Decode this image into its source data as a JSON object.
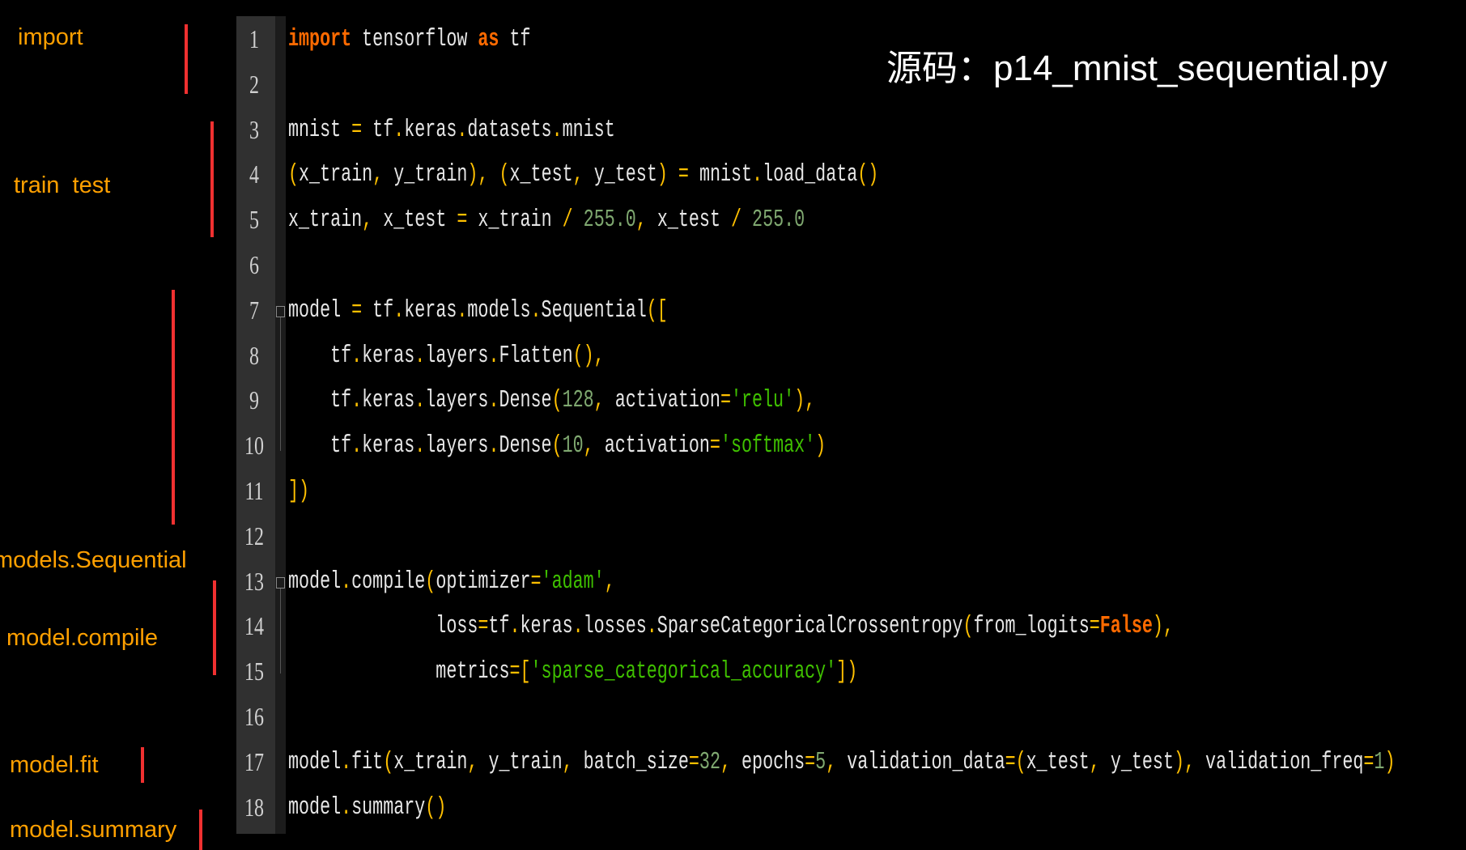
{
  "title": "源码：p14_mnist_sequential.py",
  "labels": [
    "import",
    "train  test",
    "models.Sequential",
    "model.compile",
    "model.fit",
    "model.summary"
  ],
  "colors": {
    "keyword": "#ff6a00",
    "operator": "#ffc000",
    "number": "#7fa870",
    "string": "#3fc000",
    "text": "#e6e6e6",
    "label": "#ffa000",
    "bar": "#f03030"
  },
  "code": [
    [
      [
        "import",
        "kw"
      ],
      [
        " tensorflow ",
        ""
      ],
      [
        "as",
        "kw"
      ],
      [
        " tf",
        ""
      ]
    ],
    [],
    [
      [
        "mnist ",
        ""
      ],
      [
        "=",
        "op"
      ],
      [
        " tf",
        ""
      ],
      [
        ".",
        "op"
      ],
      [
        "keras",
        ""
      ],
      [
        ".",
        "op"
      ],
      [
        "datasets",
        ""
      ],
      [
        ".",
        "op"
      ],
      [
        "mnist",
        ""
      ]
    ],
    [
      [
        "(",
        "op"
      ],
      [
        "x_train",
        ""
      ],
      [
        ", ",
        "op"
      ],
      [
        "y_train",
        ""
      ],
      [
        ")",
        "op"
      ],
      [
        ", ",
        "op"
      ],
      [
        "(",
        "op"
      ],
      [
        "x_test",
        ""
      ],
      [
        ", ",
        "op"
      ],
      [
        "y_test",
        ""
      ],
      [
        ")",
        "op"
      ],
      [
        " = ",
        "op"
      ],
      [
        "mnist",
        ""
      ],
      [
        ".",
        "op"
      ],
      [
        "load_data",
        ""
      ],
      [
        "()",
        "op"
      ]
    ],
    [
      [
        "x_train",
        ""
      ],
      [
        ", ",
        "op"
      ],
      [
        "x_test ",
        ""
      ],
      [
        "=",
        "op"
      ],
      [
        " x_train ",
        ""
      ],
      [
        "/ ",
        "op"
      ],
      [
        "255.0",
        "num"
      ],
      [
        ", ",
        "op"
      ],
      [
        "x_test ",
        ""
      ],
      [
        "/ ",
        "op"
      ],
      [
        "255.0",
        "num"
      ]
    ],
    [],
    [
      [
        "model ",
        ""
      ],
      [
        "=",
        "op"
      ],
      [
        " tf",
        ""
      ],
      [
        ".",
        "op"
      ],
      [
        "keras",
        ""
      ],
      [
        ".",
        "op"
      ],
      [
        "models",
        ""
      ],
      [
        ".",
        "op"
      ],
      [
        "Sequential",
        ""
      ],
      [
        "([",
        "op"
      ]
    ],
    [
      [
        "    tf",
        ""
      ],
      [
        ".",
        "op"
      ],
      [
        "keras",
        ""
      ],
      [
        ".",
        "op"
      ],
      [
        "layers",
        ""
      ],
      [
        ".",
        "op"
      ],
      [
        "Flatten",
        ""
      ],
      [
        "()",
        "op"
      ],
      [
        ",",
        "op"
      ]
    ],
    [
      [
        "    tf",
        ""
      ],
      [
        ".",
        "op"
      ],
      [
        "keras",
        ""
      ],
      [
        ".",
        "op"
      ],
      [
        "layers",
        ""
      ],
      [
        ".",
        "op"
      ],
      [
        "Dense",
        ""
      ],
      [
        "(",
        "op"
      ],
      [
        "128",
        "num"
      ],
      [
        ", ",
        "op"
      ],
      [
        "activation",
        ""
      ],
      [
        "=",
        "op"
      ],
      [
        "'relu'",
        "str"
      ],
      [
        ")",
        "op"
      ],
      [
        ",",
        "op"
      ]
    ],
    [
      [
        "    tf",
        ""
      ],
      [
        ".",
        "op"
      ],
      [
        "keras",
        ""
      ],
      [
        ".",
        "op"
      ],
      [
        "layers",
        ""
      ],
      [
        ".",
        "op"
      ],
      [
        "Dense",
        ""
      ],
      [
        "(",
        "op"
      ],
      [
        "10",
        "num"
      ],
      [
        ", ",
        "op"
      ],
      [
        "activation",
        ""
      ],
      [
        "=",
        "op"
      ],
      [
        "'softmax'",
        "str"
      ],
      [
        ")",
        "op"
      ]
    ],
    [
      [
        "])",
        "op"
      ]
    ],
    [],
    [
      [
        "model",
        ""
      ],
      [
        ".",
        "op"
      ],
      [
        "compile",
        ""
      ],
      [
        "(",
        "op"
      ],
      [
        "optimizer",
        ""
      ],
      [
        "=",
        "op"
      ],
      [
        "'adam'",
        "str"
      ],
      [
        ",",
        "op"
      ]
    ],
    [
      [
        "              loss",
        ""
      ],
      [
        "=",
        "op"
      ],
      [
        "tf",
        ""
      ],
      [
        ".",
        "op"
      ],
      [
        "keras",
        ""
      ],
      [
        ".",
        "op"
      ],
      [
        "losses",
        ""
      ],
      [
        ".",
        "op"
      ],
      [
        "SparseCategoricalCrossentropy",
        ""
      ],
      [
        "(",
        "op"
      ],
      [
        "from_logits",
        ""
      ],
      [
        "=",
        "op"
      ],
      [
        "False",
        "kw"
      ],
      [
        ")",
        "op"
      ],
      [
        ",",
        "op"
      ]
    ],
    [
      [
        "              metrics",
        ""
      ],
      [
        "=",
        "op"
      ],
      [
        "[",
        "op"
      ],
      [
        "'sparse_categorical_accuracy'",
        "str"
      ],
      [
        "])",
        "op"
      ]
    ],
    [],
    [
      [
        "model",
        ""
      ],
      [
        ".",
        "op"
      ],
      [
        "fit",
        ""
      ],
      [
        "(",
        "op"
      ],
      [
        "x_train",
        ""
      ],
      [
        ", ",
        "op"
      ],
      [
        "y_train",
        ""
      ],
      [
        ", ",
        "op"
      ],
      [
        "batch_size",
        ""
      ],
      [
        "=",
        "op"
      ],
      [
        "32",
        "num"
      ],
      [
        ", ",
        "op"
      ],
      [
        "epochs",
        ""
      ],
      [
        "=",
        "op"
      ],
      [
        "5",
        "num"
      ],
      [
        ", ",
        "op"
      ],
      [
        "validation_data",
        ""
      ],
      [
        "=",
        "op"
      ],
      [
        "(",
        "op"
      ],
      [
        "x_test",
        ""
      ],
      [
        ", ",
        "op"
      ],
      [
        "y_test",
        ""
      ],
      [
        ")",
        "op"
      ],
      [
        ", ",
        "op"
      ],
      [
        "validation_freq",
        ""
      ],
      [
        "=",
        "op"
      ],
      [
        "1",
        "num"
      ],
      [
        ")",
        "op"
      ]
    ],
    [
      [
        "model",
        ""
      ],
      [
        ".",
        "op"
      ],
      [
        "summary",
        ""
      ],
      [
        "()",
        "op"
      ]
    ]
  ]
}
